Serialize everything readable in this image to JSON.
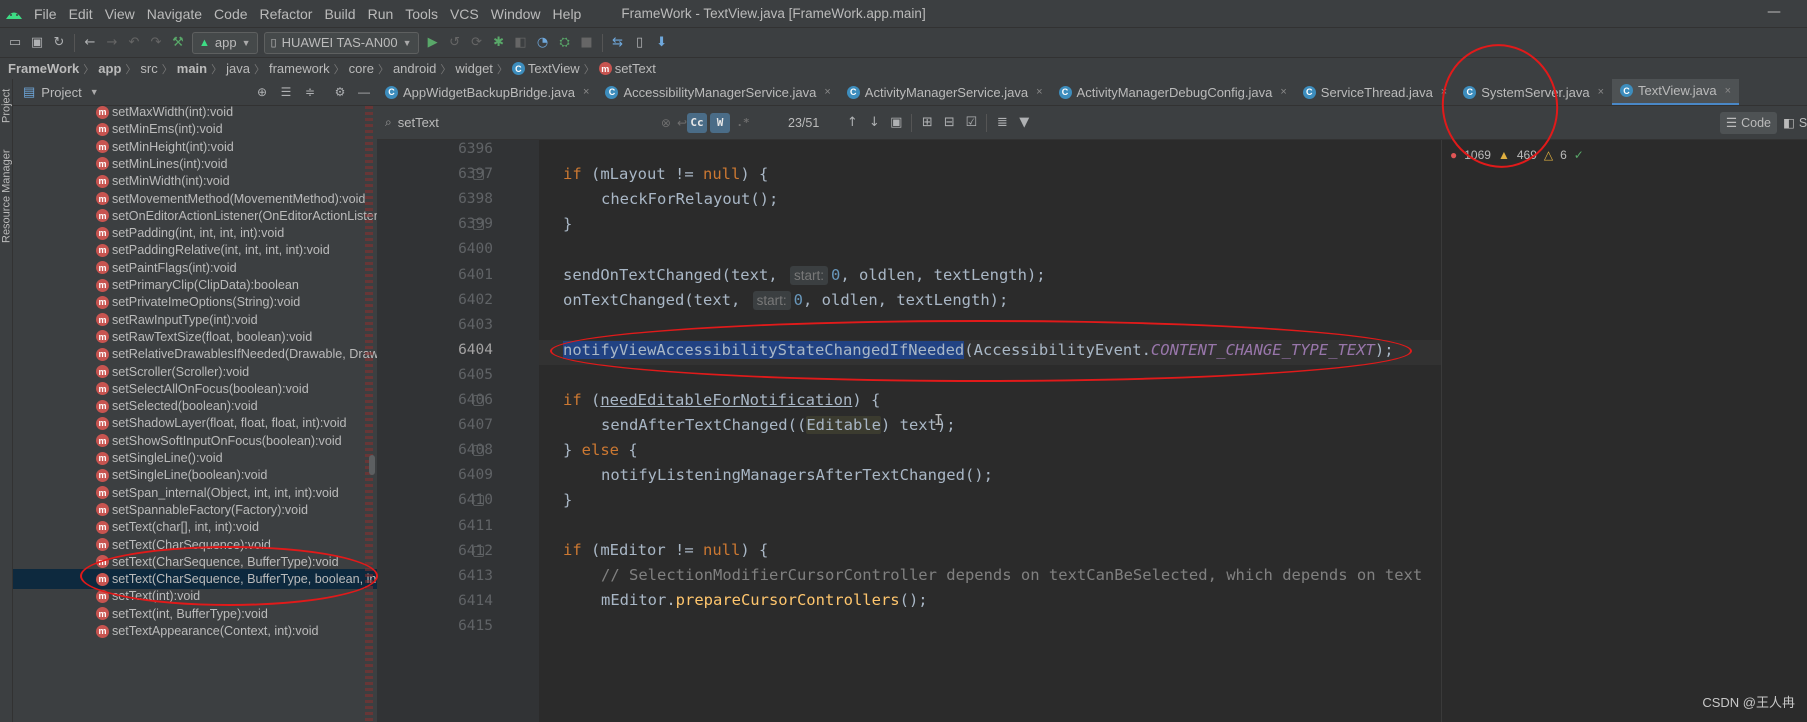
{
  "window": {
    "title": "FrameWork - TextView.java [FrameWork.app.main]",
    "minimize": "—"
  },
  "menu": [
    "File",
    "Edit",
    "View",
    "Navigate",
    "Code",
    "Refactor",
    "Build",
    "Run",
    "Tools",
    "VCS",
    "Window",
    "Help"
  ],
  "toolbar": {
    "run_config": "app",
    "device": "HUAWEI TAS-AN00"
  },
  "breadcrumb": [
    "FrameWork",
    "app",
    "src",
    "main",
    "java",
    "framework",
    "core",
    "android",
    "widget",
    "TextView",
    "setText"
  ],
  "left_strip": {
    "project_tab": "Project",
    "resource_manager_tab": "Resource Manager"
  },
  "project_panel": {
    "title": "Project",
    "items": [
      "setMaxWidth(int):void",
      "setMinEms(int):void",
      "setMinHeight(int):void",
      "setMinLines(int):void",
      "setMinWidth(int):void",
      "setMovementMethod(MovementMethod):void",
      "setOnEditorActionListener(OnEditorActionListener):void",
      "setPadding(int, int, int, int):void",
      "setPaddingRelative(int, int, int, int):void",
      "setPaintFlags(int):void",
      "setPrimaryClip(ClipData):boolean",
      "setPrivateImeOptions(String):void",
      "setRawInputType(int):void",
      "setRawTextSize(float, boolean):void",
      "setRelativeDrawablesIfNeeded(Drawable, Drawable):void",
      "setScroller(Scroller):void",
      "setSelectAllOnFocus(boolean):void",
      "setSelected(boolean):void",
      "setShadowLayer(float, float, float, int):void",
      "setShowSoftInputOnFocus(boolean):void",
      "setSingleLine():void",
      "setSingleLine(boolean):void",
      "setSpan_internal(Object, int, int, int):void",
      "setSpannableFactory(Factory):void",
      "setText(char[], int, int):void",
      "setText(CharSequence):void",
      "setText(CharSequence, BufferType):void",
      "setText(CharSequence, BufferType, boolean, int):void",
      "setText(int):void",
      "setText(int, BufferType):void",
      "setTextAppearance(Context, int):void"
    ],
    "selected_index": 27
  },
  "tabs": [
    {
      "label": "AppWidgetBackupBridge.java",
      "active": false
    },
    {
      "label": "AccessibilityManagerService.java",
      "active": false
    },
    {
      "label": "ActivityManagerService.java",
      "active": false
    },
    {
      "label": "ActivityManagerDebugConfig.java",
      "active": false
    },
    {
      "label": "ServiceThread.java",
      "active": false
    },
    {
      "label": "SystemServer.java",
      "active": false
    },
    {
      "label": "TextView.java",
      "active": true
    }
  ],
  "search": {
    "query": "setText",
    "case_toggle": "Cc",
    "word_toggle": "W",
    "regex_toggle": ".*",
    "match_count": "23/51"
  },
  "view_modes": {
    "code": "Code",
    "split": "Split"
  },
  "inspections": {
    "errors": "1069",
    "warnings": "469",
    "weak_warnings": "6"
  },
  "code": {
    "current_line": "6404",
    "lines": [
      {
        "num": "6396"
      },
      {
        "num": "6397"
      },
      {
        "num": "6398"
      },
      {
        "num": "6399"
      },
      {
        "num": "6400"
      },
      {
        "num": "6401"
      },
      {
        "num": "6402"
      },
      {
        "num": "6403"
      },
      {
        "num": "6404"
      },
      {
        "num": "6405"
      },
      {
        "num": "6406"
      },
      {
        "num": "6407"
      },
      {
        "num": "6408"
      },
      {
        "num": "6409"
      },
      {
        "num": "6410"
      },
      {
        "num": "6411"
      },
      {
        "num": "6412"
      },
      {
        "num": "6413"
      },
      {
        "num": "6414"
      },
      {
        "num": "6415"
      }
    ],
    "hint_start": "start:",
    "t": {
      "if": "if",
      "else": "else",
      "null": "null",
      "zero": "0",
      "mLayout_cond": " (mLayout != ",
      "close_brace_open": ") {",
      "checkForRelayout": "checkForRelayout",
      "call_end": "();",
      "rbrace": "}",
      "sendOnTextChanged": "sendOnTextChanged",
      "onTextChanged": "onTextChanged",
      "open_text": "(text, ",
      "args_tail": ", oldlen, textLength);",
      "notifyFn": "notifyViewAccessibilityStateChangedIfNeeded",
      "accEvent": "(AccessibilityEvent.",
      "contentChange": "CONTENT_CHANGE_TYPE_TEXT",
      "call_close": ");",
      "paren_open": " (",
      "needEditable": "needEditableForNotification",
      "sendAfter": "sendAfterTextChanged",
      "cast_open": "((",
      "editable": "Editable",
      "cast_tail": ") text);",
      "else_pre": "} ",
      "else_post": " {",
      "notifyListening": "notifyListeningManagersAfterTextChanged",
      "mEditor_cond": " (mEditor != ",
      "comment": "// SelectionModifierCursorController depends on textCanBeSelected, which depends on text",
      "mEditor": "mEditor.",
      "prepareCursor": "prepareCursorControllers"
    }
  },
  "watermark": "CSDN @王人冉",
  "colors": {
    "editor_bg": "#2b2b2b",
    "panel_bg": "#3c3f41",
    "keyword": "#cc7832",
    "function": "#ffc66d",
    "number": "#6897bb",
    "field": "#9876aa",
    "selection": "#214283",
    "annotation_red": "#e11a1a"
  }
}
